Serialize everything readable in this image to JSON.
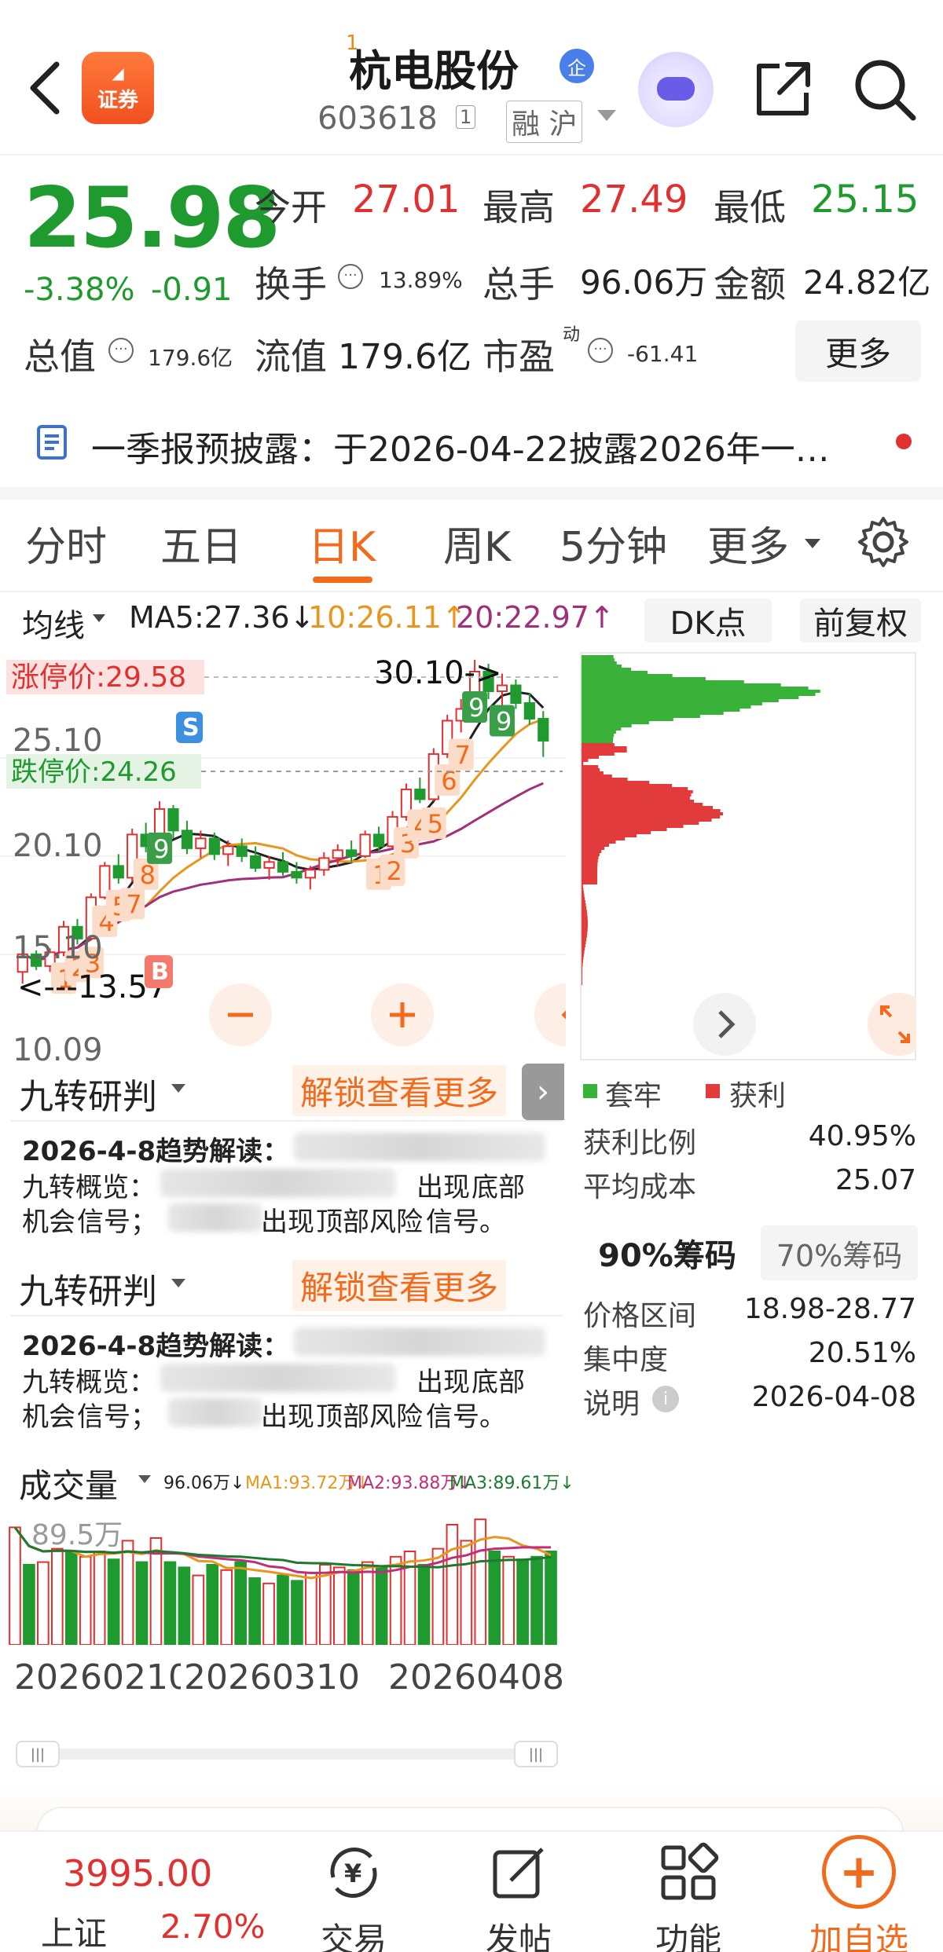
{
  "header": {
    "back_icon": "chevron-left-icon",
    "app_logo_text": "证券",
    "name_superscript": "1",
    "stock_name": "杭电股份",
    "qi_badge": "企",
    "stock_code": "603618",
    "code_tag": "1",
    "market_tags": "融 沪",
    "icons": [
      "robot-avatar-icon",
      "share-icon",
      "search-icon"
    ]
  },
  "quote": {
    "price": "25.98",
    "change_pct": "-3.38%",
    "change_val": "-0.91",
    "open_label": "今开",
    "open_val": "27.01",
    "high_label": "最高",
    "high_val": "27.49",
    "low_label": "最低",
    "low_val": "25.15",
    "turnover_label": "换手",
    "turnover_val": "13.89%",
    "volume_label": "总手",
    "volume_val": "96.06万",
    "amount_label": "金额",
    "amount_val": "24.82亿",
    "mktcap_label": "总值",
    "mktcap_val": "179.6亿",
    "float_label": "流值",
    "float_val": "179.6亿",
    "pe_label": "市盈",
    "pe_sup": "动",
    "pe_val": "-61.41",
    "more_label": "更多",
    "colors": {
      "down": "#1f9a2f",
      "up": "#e0302f"
    }
  },
  "notice": {
    "text": "一季报预披露：于2026-04-22披露2026年一…"
  },
  "tabs": [
    {
      "label": "分时"
    },
    {
      "label": "五日"
    },
    {
      "label": "日K",
      "active": true
    },
    {
      "label": "周K"
    },
    {
      "label": "5分钟"
    },
    {
      "label": "更多"
    }
  ],
  "ma_row": {
    "ma_label": "均线",
    "ma5": "MA5:27.36↓",
    "ma10": "10:26.11↑",
    "ma20": "20:22.97↑",
    "dk_label": "DK点",
    "adjust_label": "前复权"
  },
  "kline": {
    "y_labels": [
      "25.10",
      "20.10",
      "15.10",
      "10.09"
    ],
    "limit_up_label": "涨停价:29.58",
    "limit_down_label": "跌停价:24.26",
    "high_mark": "30.10->",
    "low_mark": "<---13.57",
    "signal_s": "S",
    "signal_b": "B",
    "nine_labels": [
      "1",
      "2",
      "3",
      "4",
      "5",
      "7",
      "8",
      "9",
      "1",
      "2",
      "3",
      "4",
      "5",
      "6",
      "7",
      "9",
      "9"
    ],
    "zoom_out_icon": "minus-icon",
    "zoom_in_icon": "plus-icon",
    "scroll_left_icon": "chevron-left-icon",
    "scroll_right_icon": "chevron-right-icon",
    "fullscreen_icon": "expand-icon"
  },
  "chip": {
    "legend_trapped": "套牢",
    "legend_profit": "获利",
    "profit_ratio_label": "获利比例",
    "profit_ratio_val": "40.95%",
    "avg_cost_label": "平均成本",
    "avg_cost_val": "25.07",
    "tab_90": "90%筹码",
    "tab_70": "70%筹码",
    "price_range_label": "价格区间",
    "price_range_val": "18.98-28.77",
    "concentration_label": "集中度",
    "concentration_val": "20.51%",
    "note_label": "说明",
    "note_val": "2026-04-08",
    "colors": {
      "trapped": "#3ab23a",
      "profit": "#e23b3b"
    }
  },
  "analysis_panels": [
    {
      "title": "九转研判",
      "unlock": "解锁查看更多",
      "line1": "2026-4-8趋势解读：",
      "line2a": "九转概览：",
      "line2b": "出现",
      "line2c": "底部",
      "line3a": "机会",
      "line3b": "信号；",
      "line3c": "出现",
      "line3d": "顶部风险",
      "line3e": "信号。"
    },
    {
      "title": "九转研判",
      "unlock": "解锁查看更多",
      "line1": "2026-4-8趋势解读：",
      "line2a": "九转概览：",
      "line2b": "出现",
      "line2c": "底部",
      "line3a": "机会",
      "line3b": "信号；",
      "line3c": "出现",
      "line3d": "顶部风险",
      "line3e": "信号。"
    }
  ],
  "volume": {
    "title": "成交量",
    "vol": "96.06万↓",
    "ma1": "MA1:93.72万↓",
    "ma2": "MA2:93.88万↓",
    "ma3": "MA3:89.61万↓",
    "axis_label": "89.5万",
    "x_labels": [
      "20260210",
      "20260310",
      "20260408"
    ]
  },
  "bottom": {
    "index_val": "3995.00",
    "index_name": "上证",
    "index_pct": "2.70%",
    "nav": [
      {
        "label": "交易",
        "icon": "yuan-exchange-icon"
      },
      {
        "label": "发帖",
        "icon": "edit-icon"
      },
      {
        "label": "功能",
        "icon": "grid-icon"
      },
      {
        "label": "加自选",
        "icon": "plus-icon"
      }
    ]
  },
  "chart_data": {
    "type": "candlestick",
    "title": "",
    "ylim": [
      10.09,
      30.1
    ],
    "ma5": 27.36,
    "ma10": 26.11,
    "ma20": 22.97,
    "period_high": 30.1,
    "period_low": 13.57,
    "limit_up": 29.58,
    "limit_down": 24.26,
    "x_labels": [
      "20260210",
      "20260310",
      "20260408"
    ],
    "candles": [
      [
        14.2,
        15.6,
        13.6,
        15.1
      ],
      [
        15.1,
        15.3,
        14.3,
        14.5
      ],
      [
        14.5,
        15.4,
        14.2,
        15.2
      ],
      [
        15.2,
        16.8,
        15.0,
        16.5
      ],
      [
        16.5,
        16.9,
        15.6,
        15.9
      ],
      [
        15.9,
        18.2,
        15.8,
        18.0
      ],
      [
        18.0,
        19.8,
        17.9,
        19.6
      ],
      [
        19.6,
        20.2,
        18.7,
        19.0
      ],
      [
        19.0,
        21.5,
        18.8,
        21.2
      ],
      [
        21.2,
        21.8,
        20.3,
        20.6
      ],
      [
        20.6,
        22.9,
        20.4,
        22.5
      ],
      [
        22.5,
        22.7,
        21.0,
        21.4
      ],
      [
        21.4,
        21.9,
        20.2,
        20.5
      ],
      [
        20.5,
        21.4,
        20.0,
        21.0
      ],
      [
        21.0,
        21.3,
        19.9,
        20.2
      ],
      [
        20.2,
        20.9,
        19.6,
        20.6
      ],
      [
        20.6,
        21.0,
        19.8,
        20.1
      ],
      [
        20.1,
        20.6,
        19.3,
        19.5
      ],
      [
        19.5,
        20.1,
        18.9,
        19.8
      ],
      [
        19.8,
        20.3,
        19.1,
        19.3
      ],
      [
        19.3,
        19.8,
        18.7,
        19.0
      ],
      [
        19.0,
        19.6,
        18.4,
        19.4
      ],
      [
        19.4,
        20.3,
        19.1,
        20.0
      ],
      [
        20.0,
        20.7,
        19.6,
        20.4
      ],
      [
        20.4,
        20.9,
        19.8,
        20.1
      ],
      [
        20.1,
        21.4,
        20.0,
        21.2
      ],
      [
        21.2,
        21.6,
        20.3,
        20.6
      ],
      [
        20.6,
        22.4,
        20.5,
        22.1
      ],
      [
        22.1,
        23.8,
        21.9,
        23.5
      ],
      [
        23.5,
        24.1,
        22.8,
        23.0
      ],
      [
        23.0,
        25.6,
        22.9,
        25.3
      ],
      [
        25.3,
        27.3,
        25.1,
        27.0
      ],
      [
        27.0,
        28.1,
        26.4,
        27.6
      ],
      [
        27.6,
        30.1,
        27.2,
        29.5
      ],
      [
        29.5,
        29.9,
        28.1,
        28.5
      ],
      [
        28.5,
        29.4,
        27.7,
        28.8
      ],
      [
        28.8,
        29.1,
        27.6,
        27.9
      ],
      [
        27.9,
        28.4,
        26.8,
        27.1
      ],
      [
        27.1,
        27.49,
        25.15,
        25.98
      ]
    ],
    "volume_series": [
      {
        "name": "成交量",
        "values": [
          88,
          60,
          62,
          72,
          70,
          66,
          70,
          64,
          78,
          62,
          80,
          62,
          58,
          52,
          60,
          56,
          62,
          50,
          46,
          52,
          48,
          54,
          60,
          58,
          56,
          62,
          58,
          66,
          70,
          60,
          72,
          90,
          78,
          94,
          70,
          66,
          64,
          66,
          70
        ]
      }
    ],
    "chip_distribution": {
      "price_range": [
        18.98,
        28.77
      ],
      "profit_ratio": 40.95,
      "avg_cost": 25.07
    }
  }
}
